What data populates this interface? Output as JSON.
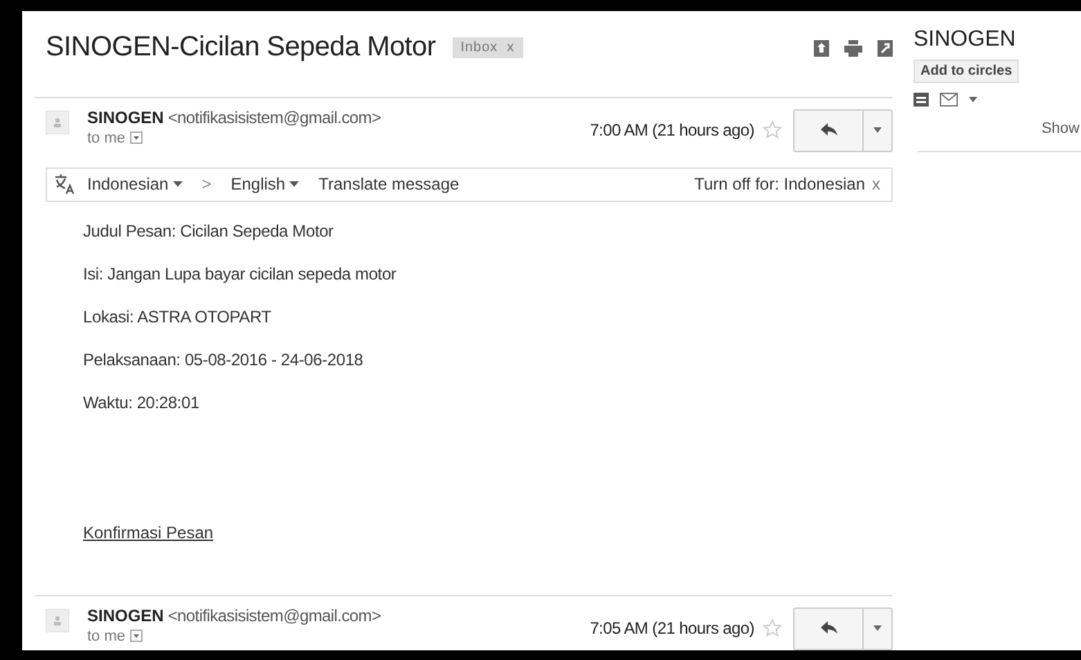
{
  "thread": {
    "subject": "SINOGEN-Cicilan Sepeda Motor",
    "label": "Inbox",
    "label_close": "x"
  },
  "messages": [
    {
      "sender": "SINOGEN",
      "email": "<notifikasisistem@gmail.com>",
      "recipient": "to me",
      "time": "7:00 AM (21 hours ago)",
      "starred": false,
      "translate": {
        "source": "Indonesian",
        "arrow": ">",
        "target": "English",
        "action": "Translate message",
        "turn_off": "Turn off for: Indonesian",
        "close": "x"
      },
      "body": [
        "Judul Pesan: Cicilan Sepeda Motor",
        "Isi: Jangan Lupa bayar cicilan sepeda motor",
        "Lokasi: ASTRA OTOPART",
        "Pelaksanaan: 05-08-2016 - 24-06-2018",
        "Waktu: 20:28:01"
      ],
      "link": "Konfirmasi Pesan"
    },
    {
      "sender": "SINOGEN",
      "email": "<notifikasisistem@gmail.com>",
      "recipient": "to me",
      "time": "7:05 AM (21 hours ago)",
      "starred": false
    }
  ],
  "contact": {
    "name": "SINOGEN",
    "button": "Add to circles",
    "more": "Show"
  }
}
